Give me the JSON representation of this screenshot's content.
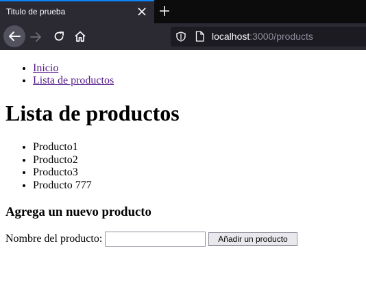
{
  "browser": {
    "tab_title": "Titulo de prueba",
    "url_host": "localhost",
    "url_path": ":3000/products"
  },
  "nav": {
    "items": [
      {
        "label": "Inicio"
      },
      {
        "label": "Lista de productos"
      }
    ]
  },
  "main": {
    "title": "Lista de productos",
    "products": [
      "Producto1",
      "Producto2",
      "Producto3",
      "Producto 777"
    ],
    "form_heading": "Agrega un nuevo producto",
    "input_label": "Nombre del producto:",
    "input_value": "",
    "submit_label": "Añadir un producto"
  },
  "colors": {
    "tab_accent": "#0a84ff",
    "visited_link": "#551a8b"
  },
  "icons": [
    "close-icon",
    "plus-icon",
    "back-arrow-icon",
    "forward-arrow-icon",
    "reload-icon",
    "home-icon",
    "shield-icon",
    "page-icon"
  ]
}
